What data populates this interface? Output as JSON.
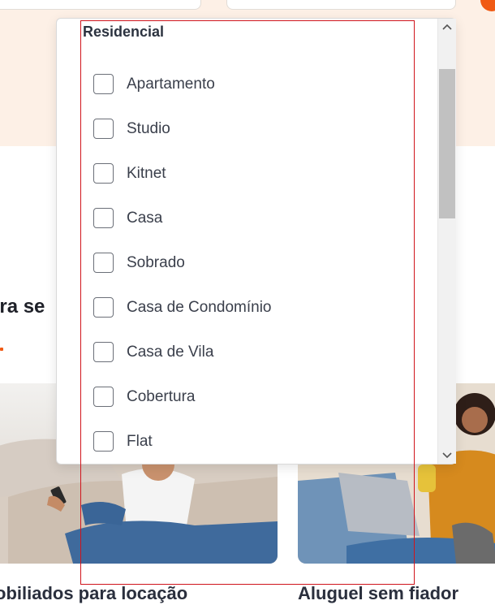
{
  "colors": {
    "brand_orange": "#f05a14",
    "hero_background": "#fdf0e6",
    "focus_outline": "#d0141c"
  },
  "background": {
    "section_heading": "ara se",
    "cards": [
      {
        "title": "obiliados para locação"
      },
      {
        "title": "Aluguel sem fiador"
      }
    ]
  },
  "dropdown": {
    "group_label": "Residencial",
    "options": [
      {
        "label": "Apartamento",
        "checked": false
      },
      {
        "label": "Studio",
        "checked": false
      },
      {
        "label": "Kitnet",
        "checked": false
      },
      {
        "label": "Casa",
        "checked": false
      },
      {
        "label": "Sobrado",
        "checked": false
      },
      {
        "label": "Casa de Condomínio",
        "checked": false
      },
      {
        "label": "Casa de Vila",
        "checked": false
      },
      {
        "label": "Cobertura",
        "checked": false
      },
      {
        "label": "Flat",
        "checked": false
      }
    ],
    "scroll_up_icon": "chevron-up-icon",
    "scroll_down_icon": "chevron-down-icon"
  }
}
